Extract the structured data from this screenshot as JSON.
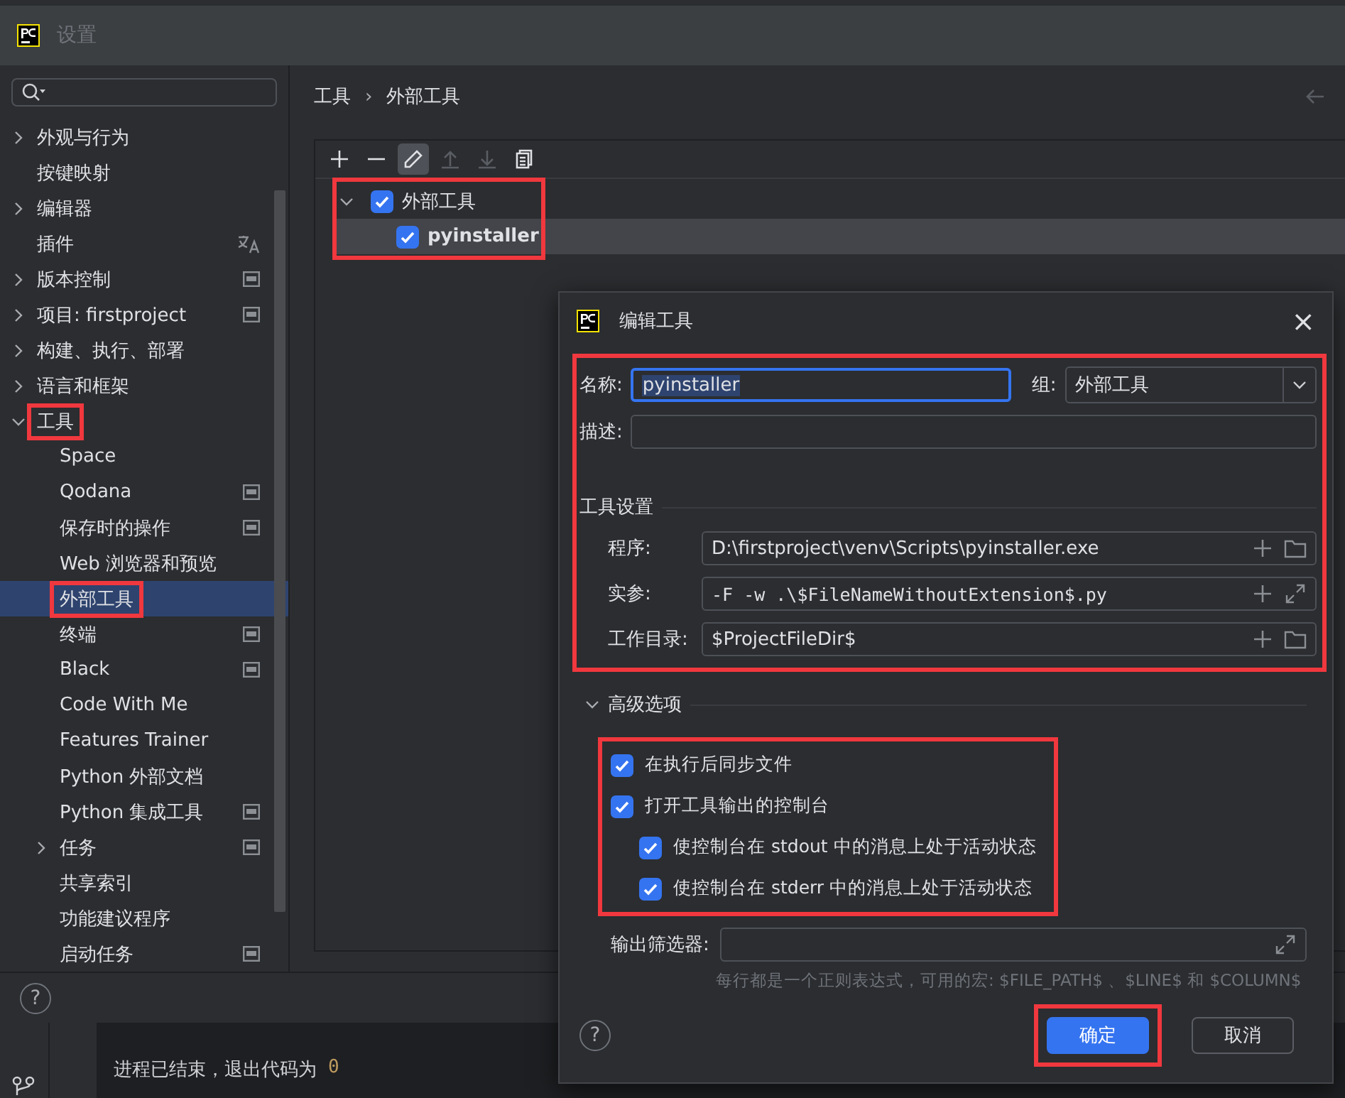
{
  "window": {
    "title": "设置"
  },
  "sidebar": {
    "items": [
      {
        "label": "外观与行为",
        "kind": "group",
        "expanded": false,
        "selected": false,
        "highlighted": false
      },
      {
        "label": "按键映射",
        "kind": "page",
        "selected": false,
        "highlighted": false
      },
      {
        "label": "编辑器",
        "kind": "group",
        "expanded": false,
        "selected": false,
        "highlighted": false
      },
      {
        "label": "插件",
        "kind": "page",
        "selected": false,
        "highlighted": false,
        "badge": {
          "kind": "language"
        }
      },
      {
        "label": "版本控制",
        "kind": "group",
        "expanded": false,
        "selected": false,
        "highlighted": false,
        "badge": {
          "kind": "project"
        }
      },
      {
        "label": "项目: firstproject",
        "kind": "group",
        "expanded": false,
        "selected": false,
        "highlighted": false,
        "badge": {
          "kind": "project"
        }
      },
      {
        "label": "构建、执行、部署",
        "kind": "group",
        "expanded": false,
        "selected": false,
        "highlighted": false
      },
      {
        "label": "语言和框架",
        "kind": "group",
        "expanded": false,
        "selected": false,
        "highlighted": false
      },
      {
        "label": "工具",
        "kind": "group",
        "expanded": true,
        "selected": false,
        "highlighted": true,
        "children": [
          {
            "label": "Space",
            "kind": "page",
            "selected": false,
            "highlighted": false
          },
          {
            "label": "Qodana",
            "kind": "page",
            "selected": false,
            "highlighted": false,
            "badge": {
              "kind": "project"
            }
          },
          {
            "label": "保存时的操作",
            "kind": "page",
            "selected": false,
            "highlighted": false,
            "badge": {
              "kind": "project"
            }
          },
          {
            "label": "Web 浏览器和预览",
            "kind": "page",
            "selected": false,
            "highlighted": false
          },
          {
            "label": "外部工具",
            "kind": "page",
            "selected": true,
            "highlighted": true
          },
          {
            "label": "终端",
            "kind": "page",
            "selected": false,
            "highlighted": false,
            "badge": {
              "kind": "project"
            }
          },
          {
            "label": "Black",
            "kind": "page",
            "selected": false,
            "highlighted": false,
            "badge": {
              "kind": "project"
            }
          },
          {
            "label": "Code With Me",
            "kind": "page",
            "selected": false,
            "highlighted": false
          },
          {
            "label": "Features Trainer",
            "kind": "page",
            "selected": false,
            "highlighted": false
          },
          {
            "label": "Python 外部文档",
            "kind": "page",
            "selected": false,
            "highlighted": false
          },
          {
            "label": "Python 集成工具",
            "kind": "page",
            "selected": false,
            "highlighted": false,
            "badge": {
              "kind": "project"
            }
          },
          {
            "label": "任务",
            "kind": "group",
            "expanded": false,
            "selected": false,
            "highlighted": false,
            "badge": {
              "kind": "project"
            }
          },
          {
            "label": "共享索引",
            "kind": "page",
            "selected": false,
            "highlighted": false
          },
          {
            "label": "功能建议程序",
            "kind": "page",
            "selected": false,
            "highlighted": false
          },
          {
            "label": "启动任务",
            "kind": "page",
            "selected": false,
            "highlighted": false,
            "badge": {
              "kind": "project"
            }
          }
        ]
      }
    ]
  },
  "breadcrumb": {
    "items": [
      "工具",
      "外部工具"
    ],
    "separator": "›"
  },
  "toolbar": [
    {
      "kind": "add",
      "selected": false,
      "disabled": false
    },
    {
      "kind": "remove",
      "selected": false,
      "disabled": false
    },
    {
      "kind": "edit",
      "selected": true,
      "disabled": false
    },
    {
      "kind": "up",
      "selected": false,
      "disabled": true
    },
    {
      "kind": "down",
      "selected": false,
      "disabled": true
    },
    {
      "kind": "copy",
      "selected": false,
      "disabled": false
    }
  ],
  "tool_tree": {
    "highlighted": true,
    "items": [
      {
        "label": "外部工具",
        "checked": true,
        "expanded": true,
        "selected": false,
        "children": [
          {
            "label": "pyinstaller",
            "checked": true,
            "selected": true
          }
        ]
      }
    ]
  },
  "help": "?",
  "console": {
    "message": "进程已结束，退出代码为",
    "exit_code": "0"
  },
  "dialog": {
    "title": "编辑工具",
    "close": "×",
    "form": {
      "highlighted": true,
      "name": {
        "label": "名称:",
        "value": "pyinstaller",
        "focused": true
      },
      "group": {
        "label": "组:",
        "value": "外部工具"
      },
      "description": {
        "label": "描述:"
      },
      "section": "工具设置",
      "rows": [
        {
          "label": "程序:",
          "value": "D:\\firstproject\\venv\\Scripts\\pyinstaller.exe",
          "kind": "path"
        },
        {
          "label": "实参:",
          "value": "-F -w .\\$FileNameWithoutExtension$.py",
          "kind": "args"
        },
        {
          "label": "工作目录:",
          "value": "$ProjectFileDir$",
          "kind": "path"
        }
      ]
    },
    "advanced": {
      "title": "高级选项",
      "expanded": true,
      "highlighted": true,
      "options": [
        {
          "label": "在执行后同步文件",
          "checked": true
        },
        {
          "label": "打开工具输出的控制台",
          "checked": true,
          "children": [
            {
              "label": "使控制台在 stdout 中的消息上处于活动状态",
              "checked": true
            },
            {
              "label": "使控制台在 stderr 中的消息上处于活动状态",
              "checked": true
            }
          ]
        }
      ]
    },
    "filter": {
      "label": "输出筛选器:",
      "hint": "每行都是一个正则表达式，可用的宏: $FILE_PATH$ 、$LINE$ 和 $COLUMN$"
    },
    "help": "?",
    "buttons": [
      {
        "label": "确定",
        "kind": "primary",
        "highlighted": true
      },
      {
        "label": "取消",
        "kind": "secondary",
        "highlighted": false
      }
    ]
  }
}
